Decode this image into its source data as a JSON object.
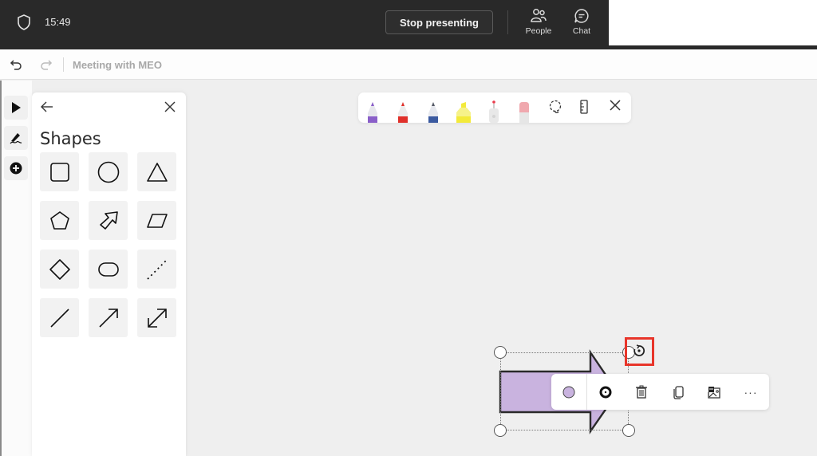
{
  "topbar": {
    "time": "15:49",
    "stop_presenting_label": "Stop presenting",
    "people_label": "People",
    "chat_label": "Chat"
  },
  "appbar": {
    "title": "Meeting with MEO",
    "undo_icon": "undo-icon",
    "redo_icon": "redo-icon"
  },
  "rail": {
    "items": [
      "select-tool",
      "ink-tool",
      "add-tool"
    ]
  },
  "shapes_panel": {
    "heading": "Shapes",
    "shapes": [
      "square",
      "circle",
      "triangle",
      "pentagon",
      "arrow-block",
      "parallelogram",
      "diamond",
      "rounded-rectangle",
      "dotted-line",
      "line",
      "arrow",
      "double-arrow"
    ]
  },
  "pen_toolbar": {
    "pens": [
      {
        "name": "purple-pen",
        "color": "#8a5fc9"
      },
      {
        "name": "red-pen",
        "color": "#e0302a"
      },
      {
        "name": "blue-pen",
        "color": "#3b5aa0"
      },
      {
        "name": "yellow-highlighter",
        "color": "#f3ea3a"
      },
      {
        "name": "laser-pointer",
        "color": "#e93a4a"
      },
      {
        "name": "eraser",
        "color": "#f0a8ae"
      }
    ],
    "tools": [
      "lasso-icon",
      "ruler-icon",
      "close-icon"
    ]
  },
  "selected_shape": {
    "type": "block-arrow",
    "fill": "#c9b3df",
    "stroke": "#2a2a2a"
  },
  "context_menu": {
    "fill_color": "#c9b3df",
    "items": [
      "fill-color",
      "outline",
      "delete",
      "copy",
      "image",
      "more"
    ],
    "more_label": "···"
  },
  "colors": {
    "highlight": "#e8352a"
  }
}
